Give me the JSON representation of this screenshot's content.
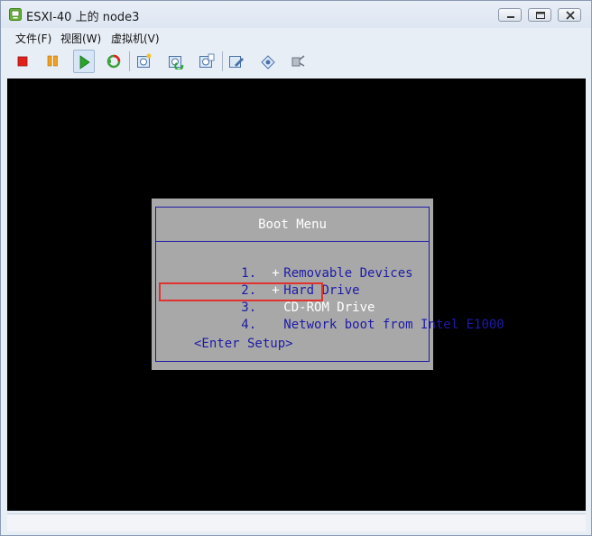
{
  "window": {
    "title": "ESXI-40 上的 node3"
  },
  "menu": {
    "file": "文件(F)",
    "view": "视图(W)",
    "vm": "虚拟机(V)"
  },
  "toolbar": {
    "icons": [
      "power-off-icon",
      "suspend-icon",
      "power-on-icon",
      "reset-icon",
      "snapshot-icon",
      "revert-snapshot-icon",
      "snapshot-manager-icon",
      "edit-settings-icon",
      "network-icon",
      "usb-icon"
    ],
    "colors": {
      "stop": "#e0201a",
      "pause": "#f0a21a",
      "play": "#2aa52a"
    }
  },
  "console": {
    "background": "#000000",
    "boot_menu": {
      "title": "Boot Menu",
      "items": [
        {
          "number": "1.",
          "prefix": "+",
          "label": "Removable Devices"
        },
        {
          "number": "2.",
          "prefix": "+",
          "label": "Hard Drive"
        },
        {
          "number": "3.",
          "prefix": "",
          "label": "CD-ROM Drive"
        },
        {
          "number": "4.",
          "prefix": "",
          "label": "Network boot from Intel E1000"
        }
      ],
      "setup": "<Enter Setup>",
      "selected_index": 2,
      "highlight_color": "#e0322e",
      "panel_color": "#a8a8a8",
      "text_color": "#1d1ba6"
    }
  }
}
